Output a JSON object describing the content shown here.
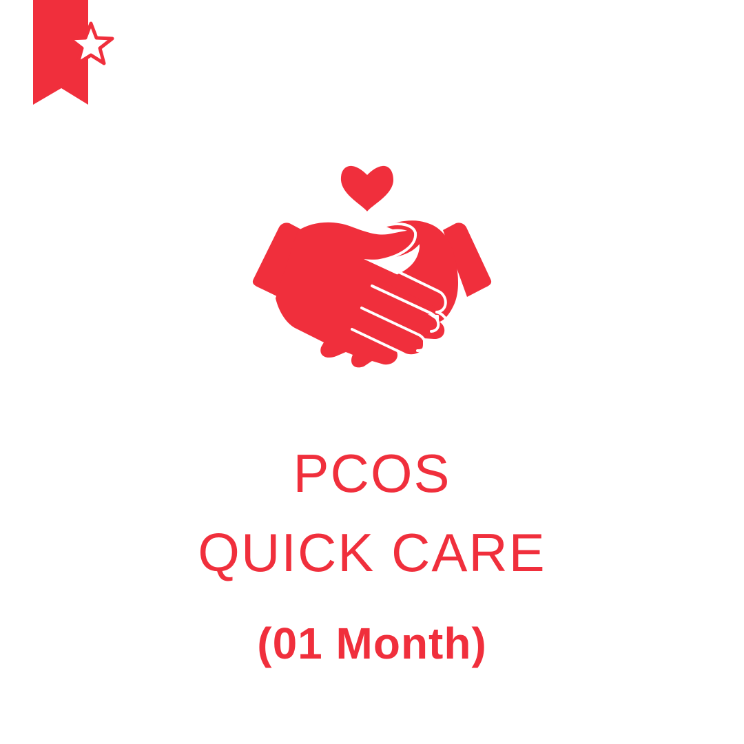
{
  "brand": {
    "accent_color": "#f02f3c",
    "logo_icon": "bookmark-star-icon"
  },
  "hero": {
    "icon": "handshake-heart-icon"
  },
  "title": {
    "line1": "PCOS",
    "line2": "QUICK CARE",
    "line3": "(01 Month)"
  }
}
